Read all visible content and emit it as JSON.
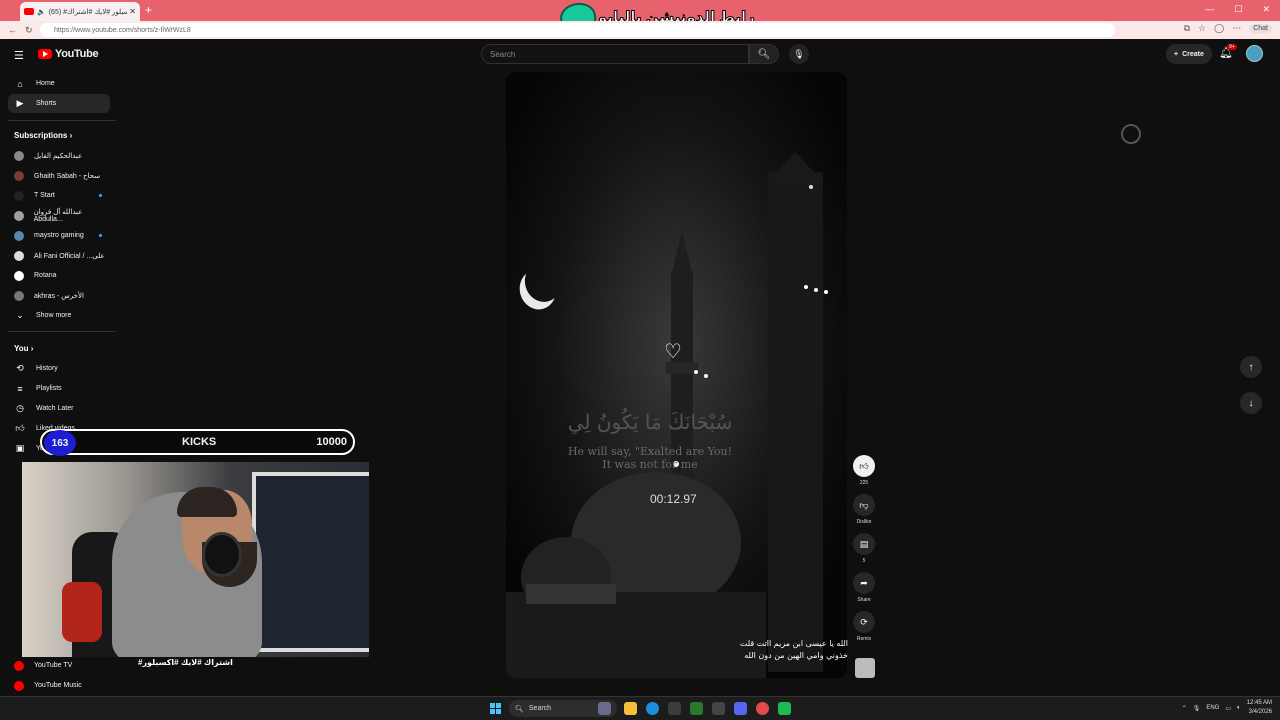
{
  "browser": {
    "tab_title": "(65) #اكسبلور #لايك #اشتراك",
    "banner_text": "رابط الدونيشن بالبايو",
    "url": "https://www.youtube.com/shorts/z-fiWrWzL8",
    "chat_label": "Chat"
  },
  "youtube": {
    "logo_text": "YouTube",
    "search_placeholder": "Search",
    "create_label": "Create",
    "notif_count": "9+"
  },
  "sidebar": {
    "main": [
      {
        "label": "Home",
        "icon": "home-icon"
      },
      {
        "label": "Shorts",
        "icon": "shorts-icon"
      }
    ],
    "subscriptions_header": "Subscriptions",
    "subscriptions": [
      {
        "label": "عبدالحكيم الفايل",
        "color": "#888888",
        "new": false
      },
      {
        "label": "Ghaith Sabah - سحاح",
        "color": "#7a3b3b",
        "new": false
      },
      {
        "label": "T Start",
        "color": "#222222",
        "new": true
      },
      {
        "label": "عبدالله آل فروان Abdulla...",
        "color": "#a0a0a0",
        "new": false
      },
      {
        "label": "maystro gaming",
        "color": "#5588aa",
        "new": true
      },
      {
        "label": "Ali Fani Official / ...على",
        "color": "#dddddd",
        "new": false
      },
      {
        "label": "Rotana",
        "color": "#ffffff",
        "new": false
      },
      {
        "label": "akhras - الأخرس",
        "color": "#777777",
        "new": false
      }
    ],
    "show_more": "Show more",
    "you_header": "You",
    "you": [
      {
        "label": "History",
        "icon": "history-icon"
      },
      {
        "label": "Playlists",
        "icon": "playlists-icon"
      },
      {
        "label": "Watch Later",
        "icon": "watch-later-icon"
      },
      {
        "label": "Liked videos",
        "icon": "like-icon"
      },
      {
        "label": "Your videos",
        "icon": "your-videos-icon"
      }
    ],
    "bottom": [
      {
        "label": "YouTube TV",
        "color": "#ff0000"
      },
      {
        "label": "YouTube Music",
        "color": "#ff0000"
      }
    ]
  },
  "short": {
    "arabic_overlay": "سُبْحَانَكَ مَا يَكُونُ لِي",
    "english_line1": "He will say, \"Exalted are You!",
    "english_line2": "It was not for me",
    "timer": "00:12.97",
    "caption_line1": "الله يا عيسى ابن مريم ااتت قلت",
    "caption_line2": "خذوني وامي الهين من دون الله",
    "actions": [
      {
        "label": "225",
        "icon": "like-icon",
        "active": true
      },
      {
        "label": "Dislike",
        "icon": "dislike-icon",
        "active": false
      },
      {
        "label": "5",
        "icon": "comment-icon",
        "active": false
      },
      {
        "label": "Share",
        "icon": "share-icon",
        "active": false
      },
      {
        "label": "Remix",
        "icon": "remix-icon",
        "active": false
      }
    ]
  },
  "overlay": {
    "kicks_count": "163",
    "kicks_label": "KICKS",
    "kicks_goal": "10000",
    "cam_caption": "#اشتراك #لايك #اكسبلور"
  },
  "taskbar": {
    "search_label": "Search",
    "lang": "ENG",
    "time": "12:45 AM",
    "date": "3/4/2026"
  }
}
